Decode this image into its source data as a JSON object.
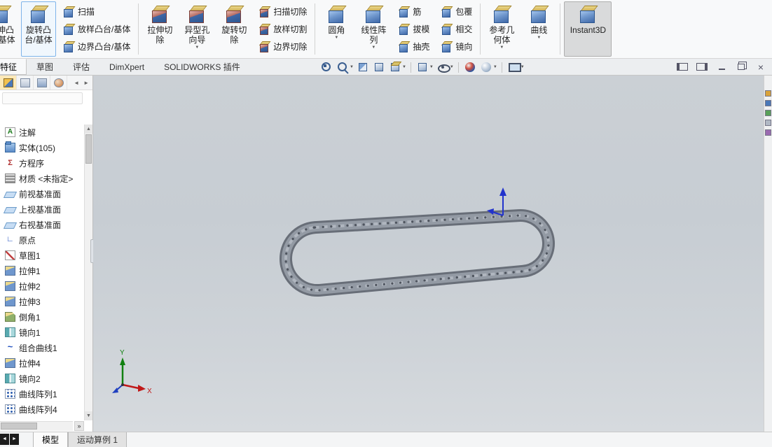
{
  "ribbon": {
    "groups": [
      {
        "columns": [
          {
            "type": "large",
            "buttons": [
              {
                "label": "拉伸凸台/基体",
                "icon": "boss-extrude"
              }
            ]
          },
          {
            "type": "large",
            "buttons": [
              {
                "label": "旋转凸台/基体",
                "icon": "boss-revolve",
                "highlight": true
              }
            ]
          },
          {
            "type": "stack",
            "buttons": [
              {
                "label": "扫描",
                "icon": "sweep"
              },
              {
                "label": "放样凸台/基体",
                "icon": "loft"
              },
              {
                "label": "边界凸台/基体",
                "icon": "boundary-boss"
              }
            ]
          }
        ]
      },
      {
        "columns": [
          {
            "type": "large",
            "buttons": [
              {
                "label": "拉伸切除",
                "icon": "cut-extrude"
              }
            ]
          },
          {
            "type": "large",
            "buttons": [
              {
                "label": "异型孔向导",
                "icon": "hole-wizard",
                "dropdown": true
              }
            ]
          },
          {
            "type": "large",
            "buttons": [
              {
                "label": "旋转切除",
                "icon": "cut-revolve"
              }
            ]
          },
          {
            "type": "stack",
            "buttons": [
              {
                "label": "扫描切除",
                "icon": "cut-sweep"
              },
              {
                "label": "放样切割",
                "icon": "cut-loft"
              },
              {
                "label": "边界切除",
                "icon": "cut-boundary"
              }
            ]
          }
        ]
      },
      {
        "columns": [
          {
            "type": "large",
            "buttons": [
              {
                "label": "圆角",
                "icon": "fillet",
                "dropdown": true
              }
            ]
          },
          {
            "type": "large",
            "buttons": [
              {
                "label": "线性阵列",
                "icon": "linear-pattern",
                "dropdown": true
              }
            ]
          },
          {
            "type": "stack",
            "buttons": [
              {
                "label": "筋",
                "icon": "rib"
              },
              {
                "label": "拔模",
                "icon": "draft"
              },
              {
                "label": "抽壳",
                "icon": "shell"
              }
            ]
          },
          {
            "type": "stack",
            "buttons": [
              {
                "label": "包覆",
                "icon": "wrap"
              },
              {
                "label": "相交",
                "icon": "intersect"
              },
              {
                "label": "镜向",
                "icon": "mirror"
              }
            ]
          }
        ]
      },
      {
        "columns": [
          {
            "type": "large",
            "buttons": [
              {
                "label": "参考几何体",
                "icon": "reference-geometry",
                "dropdown": true
              }
            ]
          },
          {
            "type": "large",
            "buttons": [
              {
                "label": "曲线",
                "icon": "curves",
                "dropdown": true
              }
            ]
          }
        ]
      },
      {
        "columns": [
          {
            "type": "large",
            "buttons": [
              {
                "label": "Instant3D",
                "icon": "instant3d",
                "active": true,
                "wide": true
              }
            ]
          }
        ]
      }
    ]
  },
  "command_tabs": [
    {
      "label": "特征",
      "active": true
    },
    {
      "label": "草图"
    },
    {
      "label": "评估"
    },
    {
      "label": "DimXpert"
    },
    {
      "label": "SOLIDWORKS 插件"
    }
  ],
  "view_toolbar": {
    "items": [
      {
        "icon": "zoom-fit"
      },
      {
        "icon": "zoom-area",
        "dropdown": true
      },
      {
        "icon": "section-view"
      },
      {
        "icon": "shaded-view"
      },
      {
        "icon": "view-orientation",
        "dropdown": true
      },
      {
        "sep": true
      },
      {
        "icon": "display-style",
        "dropdown": true
      },
      {
        "icon": "hide-show-items",
        "dropdown": true
      },
      {
        "sep": true
      },
      {
        "icon": "edit-appearance"
      },
      {
        "icon": "apply-scene",
        "dropdown": true
      },
      {
        "sep": true
      },
      {
        "icon": "view-settings",
        "dropdown": true
      }
    ]
  },
  "window_controls": [
    {
      "icon": "pane-left"
    },
    {
      "icon": "pane-right"
    },
    {
      "icon": "minimize"
    },
    {
      "icon": "restore"
    },
    {
      "icon": "close"
    }
  ],
  "feature_manager": {
    "tabs": [
      {
        "icon": "feature-manager",
        "active": true
      },
      {
        "icon": "property-manager"
      },
      {
        "icon": "configuration-manager"
      },
      {
        "icon": "display-manager"
      }
    ],
    "nav_left": "◄",
    "nav_right": "►",
    "scroll_up": "▲",
    "scroll_down": "▼",
    "expand_label": "»",
    "items": [
      {
        "label": "注解",
        "icon": "annotations"
      },
      {
        "label": "实体(105)",
        "icon": "solid-bodies"
      },
      {
        "label": "方程序",
        "icon": "equations"
      },
      {
        "label": "材质 <未指定>",
        "icon": "material"
      },
      {
        "label": "前视基准面",
        "icon": "plane"
      },
      {
        "label": "上视基准面",
        "icon": "plane"
      },
      {
        "label": "右视基准面",
        "icon": "plane"
      },
      {
        "label": "原点",
        "icon": "origin"
      },
      {
        "label": "草图1",
        "icon": "sketch"
      },
      {
        "label": "拉伸1",
        "icon": "extrude"
      },
      {
        "label": "拉伸2",
        "icon": "extrude"
      },
      {
        "label": "拉伸3",
        "icon": "extrude"
      },
      {
        "label": "倒角1",
        "icon": "chamfer"
      },
      {
        "label": "镜向1",
        "icon": "mirror"
      },
      {
        "label": "组合曲线1",
        "icon": "comp-curve"
      },
      {
        "label": "拉伸4",
        "icon": "extrude"
      },
      {
        "label": "镜向2",
        "icon": "mirror"
      },
      {
        "label": "曲线阵列1",
        "icon": "curve-pattern"
      },
      {
        "label": "曲线阵列4",
        "icon": "curve-pattern"
      }
    ]
  },
  "model_tabs": {
    "nav": [
      "◄",
      "►"
    ],
    "items": [
      {
        "label": "模型",
        "active": true
      },
      {
        "label": "运动算例 1"
      }
    ]
  },
  "task_pane": {
    "icons": [
      "design-library",
      "file-explorer",
      "view-palette",
      "appearances",
      "custom-properties"
    ]
  },
  "viewport": {
    "model": "roller-chain-loop",
    "triad_labels": {
      "x": "X",
      "y": "Y"
    }
  },
  "colors": {
    "selection_highlight": "#7eb4ea",
    "instant3d_active_bg": "#d9dadb",
    "viewport_gradient_top": "#cbd0d5",
    "viewport_gradient_bottom": "#d6dade",
    "chain_body": "#939aa4",
    "triad_x": "#c01818",
    "triad_y": "#108010",
    "origin_arrow": "#2233cc"
  }
}
